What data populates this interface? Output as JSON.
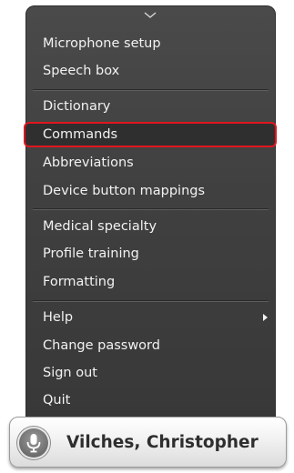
{
  "menu": {
    "groups": [
      {
        "items": [
          {
            "label": "Microphone setup"
          },
          {
            "label": "Speech box"
          }
        ]
      },
      {
        "items": [
          {
            "label": "Dictionary"
          },
          {
            "label": "Commands",
            "selected": true
          },
          {
            "label": "Abbreviations"
          },
          {
            "label": "Device button mappings"
          }
        ]
      },
      {
        "items": [
          {
            "label": "Medical specialty"
          },
          {
            "label": "Profile training"
          },
          {
            "label": "Formatting"
          }
        ]
      },
      {
        "items": [
          {
            "label": "Help",
            "has_submenu": true
          },
          {
            "label": "Change password"
          },
          {
            "label": "Sign out"
          },
          {
            "label": "Quit"
          }
        ]
      }
    ]
  },
  "user": {
    "name": "Vilches, Christopher",
    "icon": "microphone-icon"
  },
  "colors": {
    "menu_background": "#404040",
    "menu_text": "#f2f2f2",
    "highlight_border": "#e0161e",
    "user_text": "#2e2e2e"
  }
}
